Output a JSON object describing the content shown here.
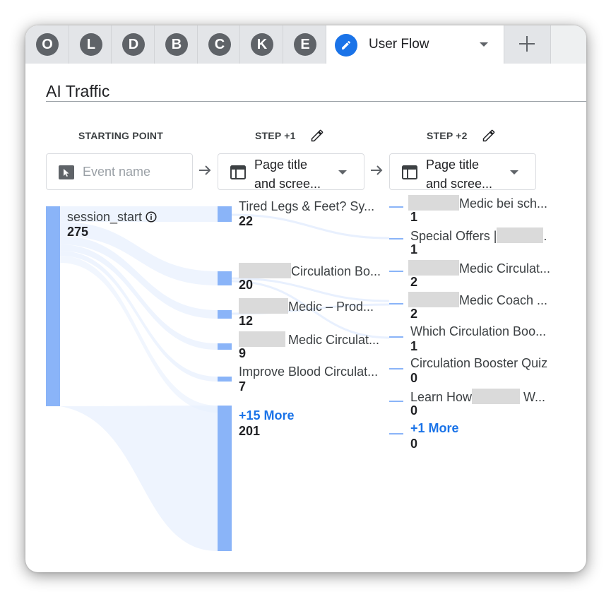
{
  "tabs": [
    {
      "letter": "O"
    },
    {
      "letter": "L"
    },
    {
      "letter": "D"
    },
    {
      "letter": "B"
    },
    {
      "letter": "C"
    },
    {
      "letter": "K"
    },
    {
      "letter": "E"
    }
  ],
  "active_tab": {
    "label": "User Flow",
    "icon": "pencil-icon"
  },
  "new_tab": {
    "icon": "plus-icon"
  },
  "report_title": "AI Traffic",
  "columns": {
    "starting_point": {
      "header": "STARTING POINT",
      "dropdown_placeholder": "Event name",
      "dropdown_icon": "cursor-icon"
    },
    "step1": {
      "header": "STEP +1",
      "dropdown_line1": "Page title",
      "dropdown_line2": "and scree...",
      "dropdown_icon": "table-icon"
    },
    "step2": {
      "header": "STEP +2",
      "dropdown_line1": "Page title",
      "dropdown_line2": "and scree...",
      "dropdown_icon": "table-icon"
    }
  },
  "start_node": {
    "label": "session_start",
    "value": "275"
  },
  "step1_nodes": [
    {
      "label": "Tired Legs & Feet? Sy...",
      "value": "22"
    },
    {
      "label": "Circulation Bo...",
      "value": "20"
    },
    {
      "label": "Medic – Prod...",
      "value": "12"
    },
    {
      "label": "Medic Circulat...",
      "value": "9"
    },
    {
      "label": "Improve Blood Circulat...",
      "value": "7"
    },
    {
      "label": "+15 More",
      "value": "201"
    }
  ],
  "step2_nodes": [
    {
      "label": "Medic bei sch...",
      "value": "1"
    },
    {
      "label": "Special Offers |",
      "label_suffix": ".",
      "value": "1"
    },
    {
      "label": "Medic Circulat...",
      "value": "2"
    },
    {
      "label": "Medic Coach ...",
      "value": "2"
    },
    {
      "label": "Which Circulation Boo...",
      "value": "1"
    },
    {
      "label": "Circulation Booster Quiz",
      "value": "0"
    },
    {
      "label": "Learn How",
      "label_suffix": "W...",
      "value": "0"
    },
    {
      "label": "+1 More",
      "value": "0"
    }
  ],
  "colors": {
    "accent": "#1a73e8",
    "flow_bar": "#8ab4f8",
    "flow_band": "#e8f0fe"
  }
}
